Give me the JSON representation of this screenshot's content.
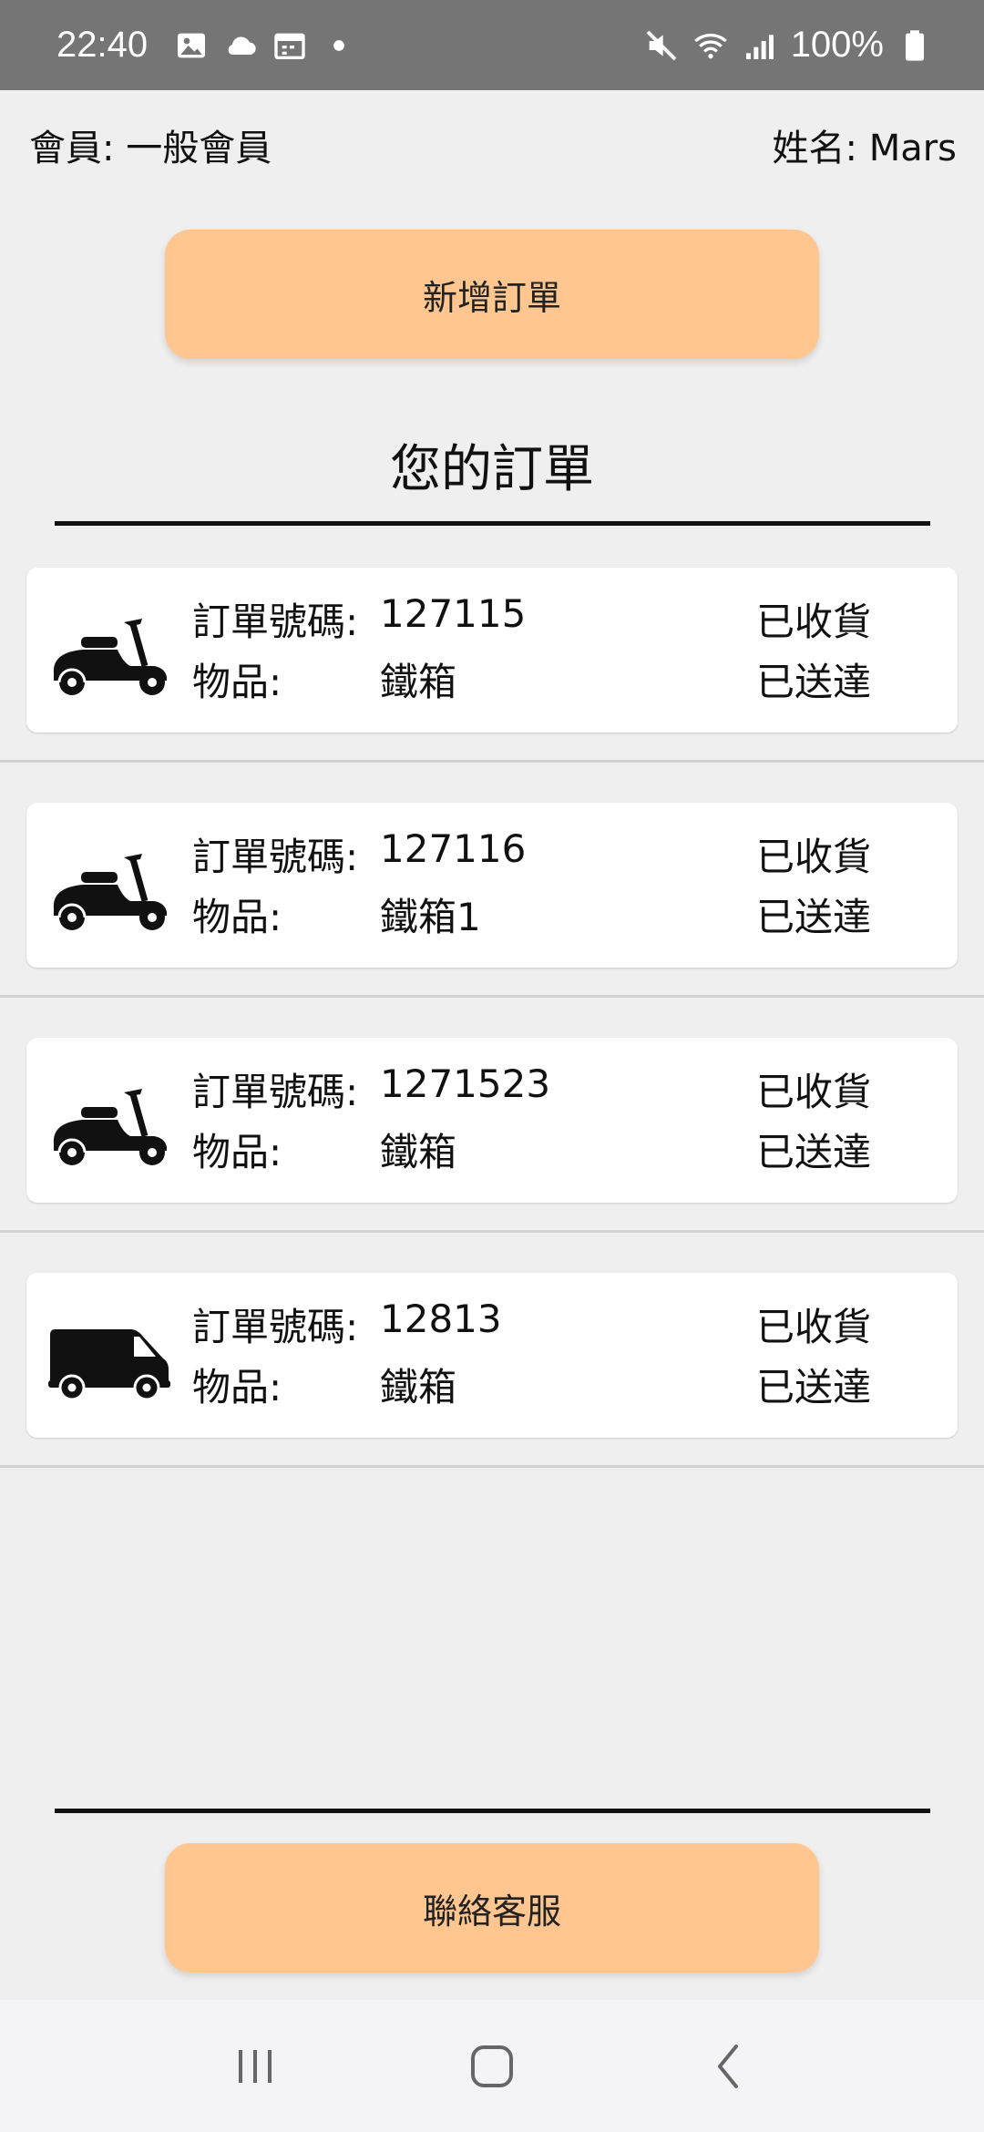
{
  "status_bar": {
    "time": "22:40",
    "battery": "100%",
    "left_icons": [
      "image-icon",
      "cloud-icon",
      "calendar-icon",
      "dot-icon"
    ],
    "right_icons": [
      "mute-icon",
      "wifi-icon",
      "signal-icon",
      "battery-icon"
    ]
  },
  "member": {
    "level": "會員: 一般會員",
    "name": "姓名: Mars"
  },
  "buttons": {
    "new_order": "新增訂單",
    "contact": "聯絡客服"
  },
  "orders_title": "您的訂單",
  "orders": [
    {
      "vehicle": "scooter-icon",
      "order_label": "訂單號碼:",
      "order_no": "127115",
      "item_label": "物品:",
      "item": "鐵箱",
      "receive_status": "已收貨",
      "delivery_status": "已送達"
    },
    {
      "vehicle": "scooter-icon",
      "order_label": "訂單號碼:",
      "order_no": "127116",
      "item_label": "物品:",
      "item": "鐵箱1",
      "receive_status": "已收貨",
      "delivery_status": "已送達"
    },
    {
      "vehicle": "scooter-icon",
      "order_label": "訂單號碼:",
      "order_no": "1271523",
      "item_label": "物品:",
      "item": "鐵箱",
      "receive_status": "已收貨",
      "delivery_status": "已送達"
    },
    {
      "vehicle": "van-icon",
      "order_label": "訂單號碼:",
      "order_no": "12813",
      "item_label": "物品:",
      "item": "鐵箱",
      "receive_status": "已收貨",
      "delivery_status": "已送達"
    }
  ],
  "nav": [
    "recents-icon",
    "home-icon",
    "back-icon"
  ],
  "colors": {
    "status_bar": "#757575",
    "accent_button": "#ffc78f",
    "background": "#efefef"
  }
}
